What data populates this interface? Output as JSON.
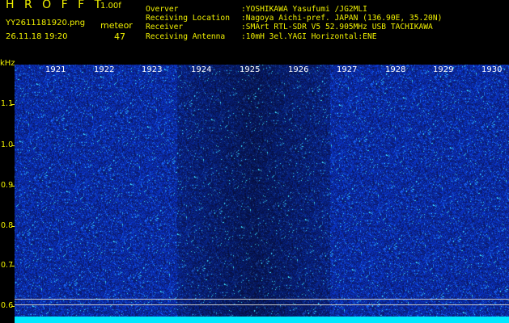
{
  "header": {
    "app_title": "H R O F F T",
    "version": "1.00f",
    "filename": "YY2611181920.png",
    "datetime": "26.11.18 19:20",
    "meteor_label": "meteor",
    "meteor_count": "47"
  },
  "info": [
    {
      "key": "Overver",
      "value": ":YOSHIKAWA Yasufumi /JG2MLI"
    },
    {
      "key": "Receiving Location",
      "value": ":Nagoya Aichi-pref. JAPAN (136.90E, 35.20N)"
    },
    {
      "key": "Receiver",
      "value": ":SMArt RTL-SDR V5 52.905MHz USB TACHIKAWA"
    },
    {
      "key": "Receiving Antenna",
      "value": ":10mH 3el.YAGI Horizontal:ENE"
    }
  ],
  "y_axis": {
    "unit": "kHz",
    "labels": [
      "1.1",
      "1.0",
      "0.9",
      "0.8",
      "0.7",
      "0.6"
    ]
  },
  "x_axis": {
    "labels": [
      "1921",
      "1922",
      "1923",
      "1924",
      "1925",
      "1926",
      "1927",
      "1928",
      "1929",
      "1930"
    ]
  },
  "colors": {
    "text_yellow": "#f0f000",
    "background": "#000000",
    "noise_blue": "#1428c8",
    "noise_cyan": "#30e8ff",
    "bottom_band": "#00e8ff"
  }
}
